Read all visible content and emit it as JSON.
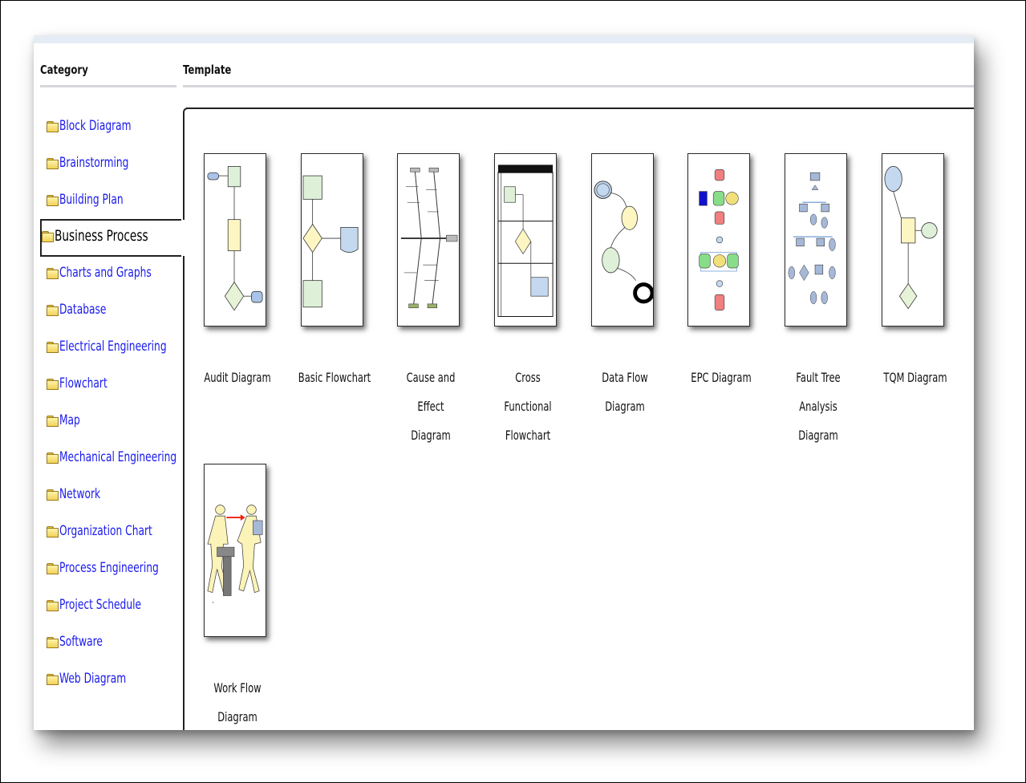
{
  "headers": {
    "category": "Category",
    "template": "Template"
  },
  "categories": [
    {
      "label": "Block Diagram",
      "selected": false
    },
    {
      "label": "Brainstorming",
      "selected": false
    },
    {
      "label": "Building Plan",
      "selected": false
    },
    {
      "label": "Business Process",
      "selected": true
    },
    {
      "label": "Charts and Graphs",
      "selected": false
    },
    {
      "label": "Database",
      "selected": false
    },
    {
      "label": "Electrical Engineering",
      "selected": false
    },
    {
      "label": "Flowchart",
      "selected": false
    },
    {
      "label": "Map",
      "selected": false
    },
    {
      "label": "Mechanical Engineering",
      "selected": false
    },
    {
      "label": "Network",
      "selected": false
    },
    {
      "label": "Organization Chart",
      "selected": false
    },
    {
      "label": "Process Engineering",
      "selected": false
    },
    {
      "label": "Project Schedule",
      "selected": false
    },
    {
      "label": "Software",
      "selected": false
    },
    {
      "label": "Web Diagram",
      "selected": false
    }
  ],
  "templates": [
    {
      "label_line1": "Audit Diagram",
      "label_line2": ""
    },
    {
      "label_line1": "Basic Flowchart",
      "label_line2": ""
    },
    {
      "label_line1": "Cause and Effect",
      "label_line2": "Diagram"
    },
    {
      "label_line1": "Cross Functional",
      "label_line2": "Flowchart"
    },
    {
      "label_line1": "Data Flow Diagram",
      "label_line2": ""
    },
    {
      "label_line1": "EPC Diagram",
      "label_line2": ""
    },
    {
      "label_line1": "Fault Tree Analysis",
      "label_line2": "Diagram"
    },
    {
      "label_line1": "TQM Diagram",
      "label_line2": ""
    },
    {
      "label_line1": "Work Flow Diagram",
      "label_line2": ""
    }
  ],
  "colors": {
    "link": "#1a1aee",
    "folder": "#f1d25a",
    "header_rule": "#d4d6da"
  }
}
